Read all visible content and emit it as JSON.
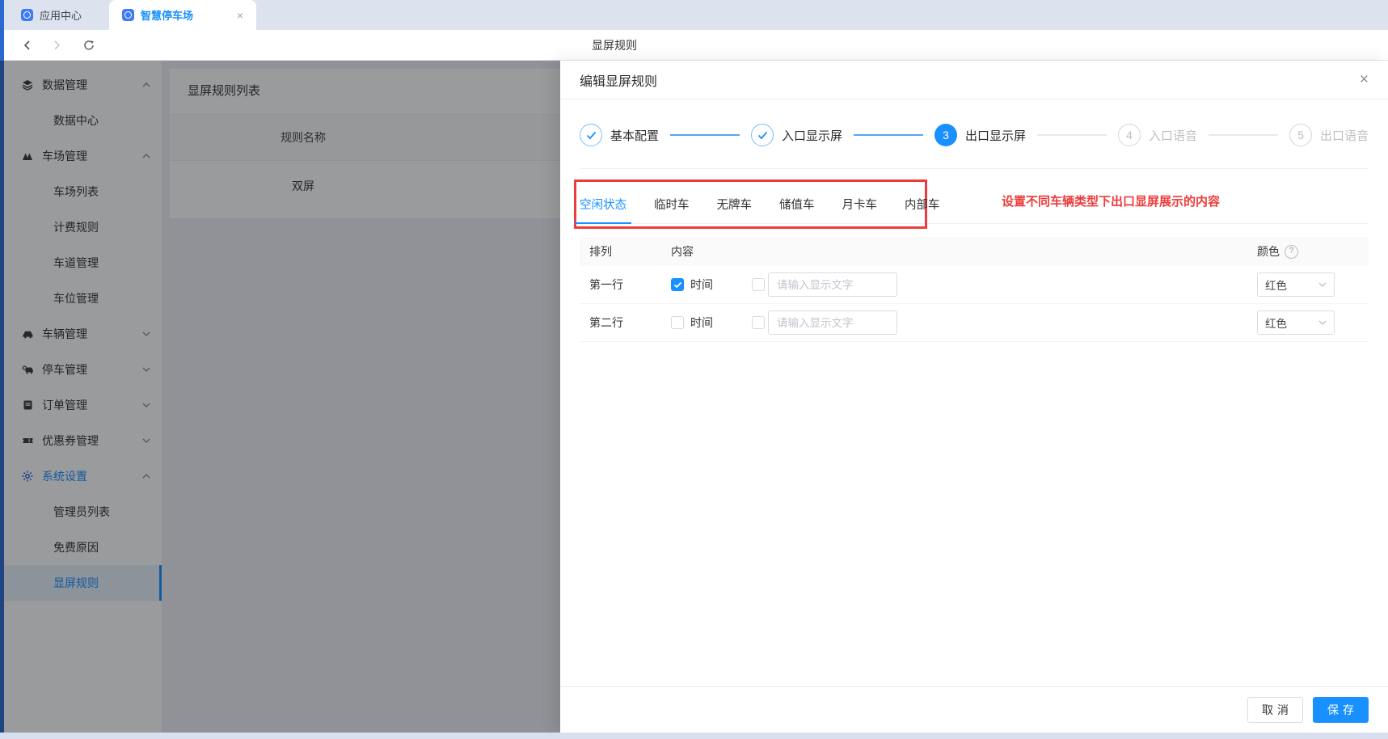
{
  "colors": {
    "accent": "#1890ff",
    "annotation_red": "#ee3b3b",
    "tabbar_bg": "#dde3ee",
    "page_bg": "#eef0f4",
    "selected_item_bg": "#e7f1fc",
    "save_button_bg": "#1890ff",
    "left_strip_blue": "#2a6ad0"
  },
  "icons": {
    "close": "×",
    "tab_close": "×",
    "help": "?"
  },
  "browser": {
    "tabs": [
      {
        "label": "应用中心",
        "active": false
      },
      {
        "label": "智慧停车场",
        "active": true
      }
    ],
    "nav_title": "显屏规则"
  },
  "sidebar": {
    "items": [
      {
        "label": "数据管理"
      },
      {
        "label": "数据中心"
      },
      {
        "label": "车场管理"
      },
      {
        "label": "车场列表"
      },
      {
        "label": "计费规则"
      },
      {
        "label": "车道管理"
      },
      {
        "label": "车位管理"
      },
      {
        "label": "车辆管理"
      },
      {
        "label": "停车管理"
      },
      {
        "label": "订单管理"
      },
      {
        "label": "优惠券管理"
      },
      {
        "label": "系统设置"
      },
      {
        "label": "管理员列表"
      },
      {
        "label": "免费原因"
      },
      {
        "label": "显屏规则"
      }
    ]
  },
  "main": {
    "card_title": "显屏规则列表",
    "table": {
      "columns": [
        "规则名称"
      ],
      "rows": [
        [
          "双屏"
        ]
      ]
    }
  },
  "drawer": {
    "title": "编辑显屏规则",
    "steps": [
      {
        "label": "基本配置",
        "status": "finished"
      },
      {
        "label": "入口显示屏",
        "status": "finished"
      },
      {
        "label": "出口显示屏",
        "status": "active",
        "number": "3"
      },
      {
        "label": "入口语音",
        "status": "waiting",
        "number": "4"
      },
      {
        "label": "出口语音",
        "status": "waiting",
        "number": "5"
      }
    ],
    "tabs": [
      {
        "label": "空闲状态",
        "active": true
      },
      {
        "label": "临时车",
        "active": false
      },
      {
        "label": "无牌车",
        "active": false
      },
      {
        "label": "储值车",
        "active": false
      },
      {
        "label": "月卡车",
        "active": false
      },
      {
        "label": "内部车",
        "active": false
      }
    ],
    "annotation": "设置不同车辆类型下出口显屏展示的内容",
    "table": {
      "headers": {
        "arrange": "排列",
        "content": "内容",
        "color": "颜色"
      },
      "rows": [
        {
          "label": "第一行",
          "time_label": "时间",
          "time_checked": true,
          "custom_checked": false,
          "input_value": "",
          "input_placeholder": "请输入显示文字",
          "color_value": "红色"
        },
        {
          "label": "第二行",
          "time_label": "时间",
          "time_checked": false,
          "custom_checked": false,
          "input_value": "",
          "input_placeholder": "请输入显示文字",
          "color_value": "红色"
        }
      ]
    },
    "footer": {
      "cancel": "取消",
      "save": "保存"
    }
  }
}
